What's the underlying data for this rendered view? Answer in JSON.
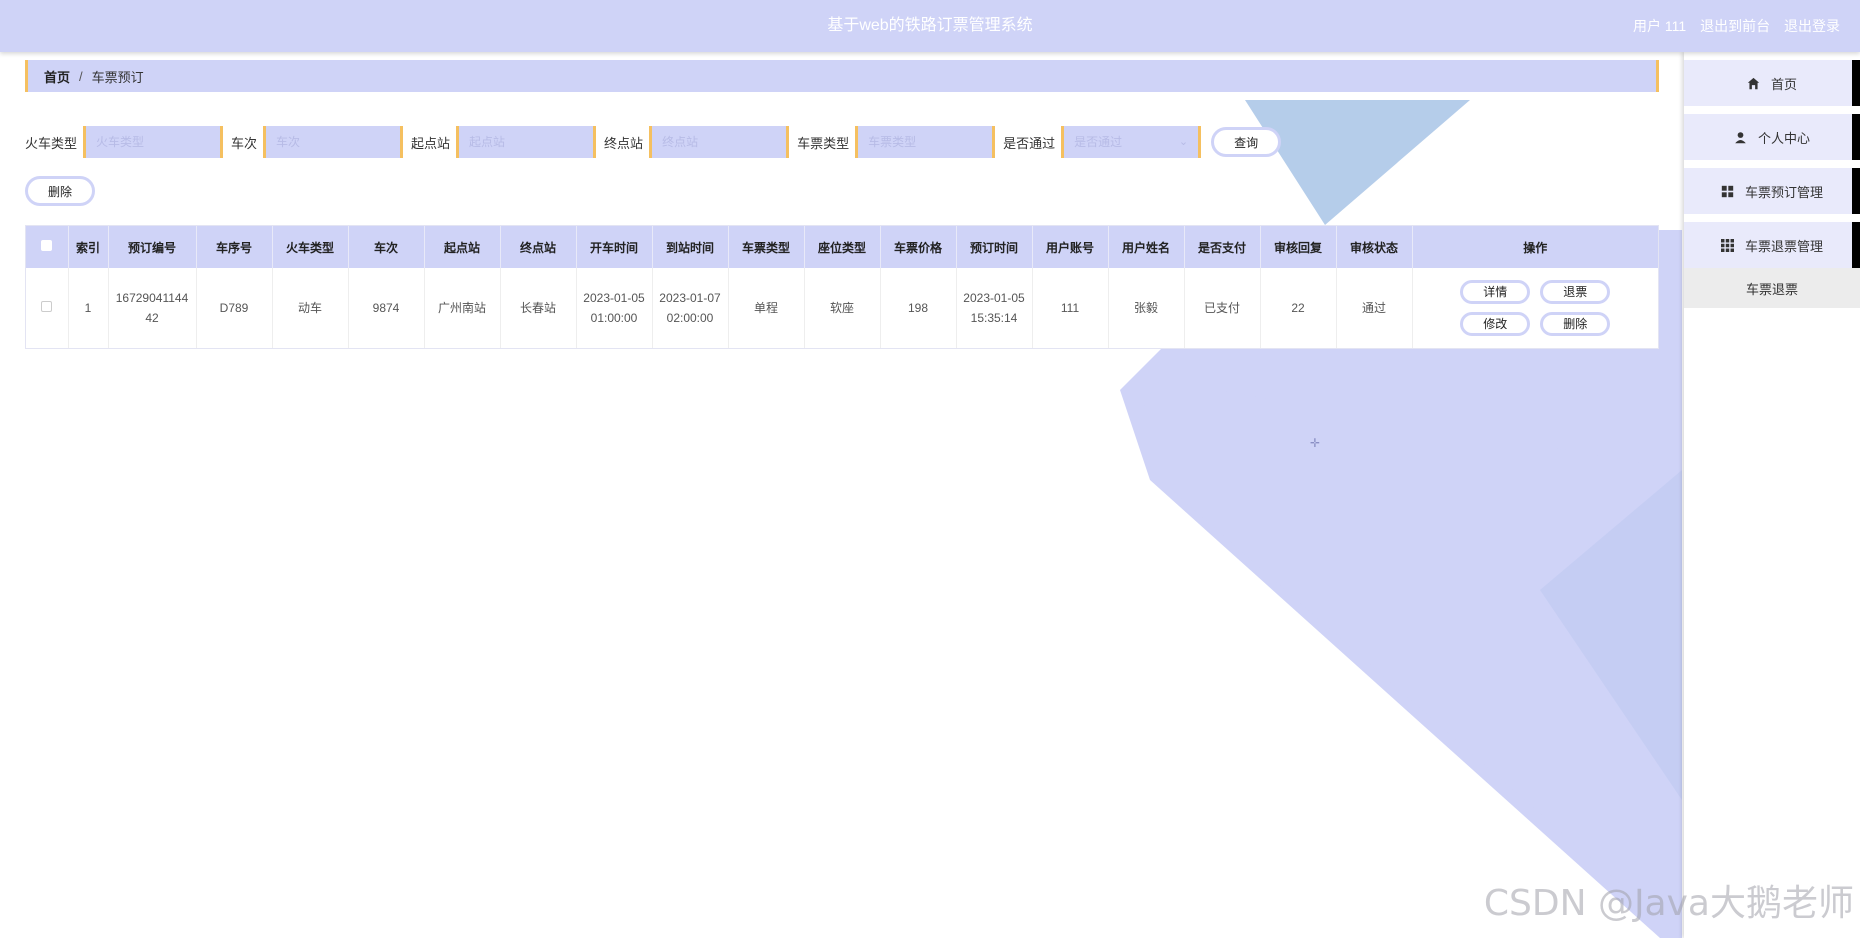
{
  "header": {
    "title": "基于web的铁路订票管理系统",
    "user_label": "用户 111",
    "back_front_label": "退出到前台",
    "logout_label": "退出登录"
  },
  "colors": {
    "accent": "#cfd3f7",
    "border_accent": "#f5c060",
    "menu_bg": "#e9eafb"
  },
  "sidebar": {
    "items": [
      {
        "label": "首页",
        "icon": "home-icon"
      },
      {
        "label": "个人中心",
        "icon": "user-icon"
      },
      {
        "label": "车票预订管理",
        "icon": "grid-icon"
      },
      {
        "label": "车票退票管理",
        "icon": "apps-icon"
      }
    ],
    "submenu": {
      "label": "车票退票"
    }
  },
  "breadcrumb": {
    "home": "首页",
    "separator": "/",
    "current": "车票预订"
  },
  "search": {
    "train_type": {
      "label": "火车类型",
      "placeholder": "火车类型"
    },
    "train_no": {
      "label": "车次",
      "placeholder": "车次"
    },
    "start": {
      "label": "起点站",
      "placeholder": "起点站"
    },
    "end": {
      "label": "终点站",
      "placeholder": "终点站"
    },
    "ticket_type": {
      "label": "车票类型",
      "placeholder": "车票类型"
    },
    "passed": {
      "label": "是否通过",
      "placeholder": "是否通过"
    },
    "query_label": "查询"
  },
  "actions": {
    "delete_label": "删除"
  },
  "table": {
    "headers": [
      "索引",
      "预订编号",
      "车序号",
      "火车类型",
      "车次",
      "起点站",
      "终点站",
      "开车时间",
      "到站时间",
      "车票类型",
      "座位类型",
      "车票价格",
      "预订时间",
      "用户账号",
      "用户姓名",
      "是否支付",
      "审核回复",
      "审核状态",
      "操作"
    ],
    "rows": [
      {
        "index": "1",
        "order_no": "1672904114442",
        "seq_no": "D789",
        "train_type": "动车",
        "train_no": "9874",
        "start": "广州南站",
        "end": "长春站",
        "depart_time": "2023-01-05 01:00:00",
        "arrive_time": "2023-01-07 02:00:00",
        "ticket_type": "单程",
        "seat_type": "软座",
        "price": "198",
        "order_time": "2023-01-05 15:35:14",
        "account": "111",
        "name": "张毅",
        "paid": "已支付",
        "reply": "22",
        "status": "通过",
        "ops": {
          "detail": "详情",
          "refund": "退票",
          "edit": "修改",
          "delete": "删除"
        }
      }
    ]
  },
  "watermark": "CSDN @Java大鹅老师"
}
